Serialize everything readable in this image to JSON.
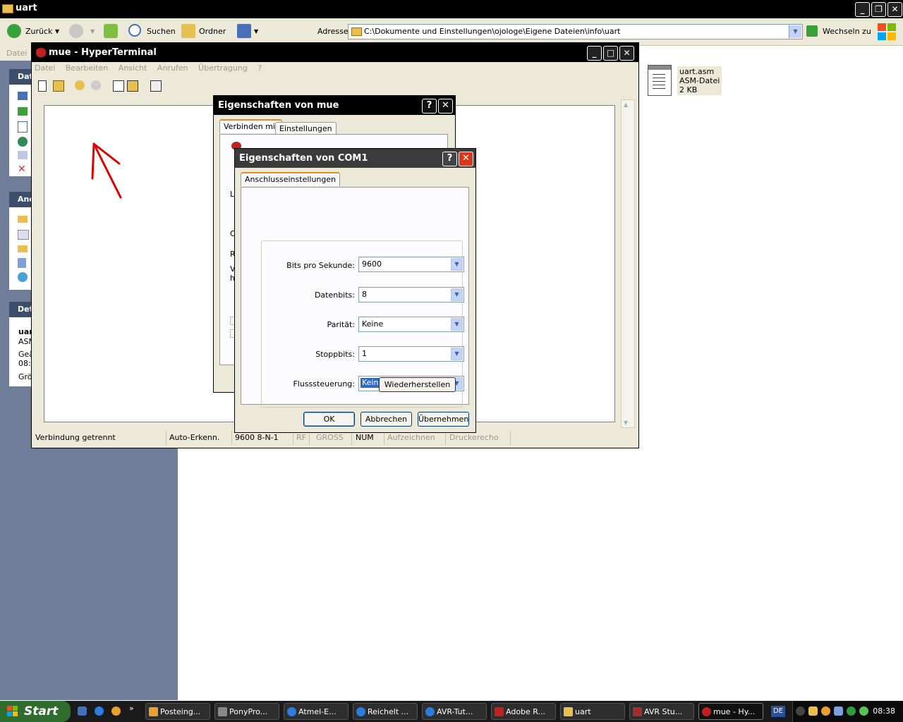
{
  "explorer": {
    "title": "uart",
    "toolbar": {
      "back": "Zurück",
      "search": "Suchen",
      "folders": "Ordner"
    },
    "address_label": "Adresse",
    "address_value": "C:\\Dokumente und Einstellungen\\ojologe\\Eigene Dateien\\info\\uart",
    "go_label": "Wechseln zu",
    "menu_first": "Datei",
    "left_pane": {
      "section1": "Dat",
      "section2": "And",
      "section3": "Det",
      "details": [
        "uar",
        "ASM",
        "Geä",
        "08:",
        "Grö"
      ]
    },
    "file": {
      "name": "uart.asm",
      "type": "ASM-Datei",
      "size": "2 KB"
    }
  },
  "hyperterminal": {
    "title": "mue - HyperTerminal",
    "menu": [
      "Datei",
      "Bearbeiten",
      "Ansicht",
      "Anrufen",
      "Übertragung",
      "?"
    ],
    "status": [
      "Verbindung getrennt",
      "Auto-Erkenn.",
      "9600 8-N-1",
      "RF",
      "GROSS",
      "NUM",
      "Aufzeichnen",
      "Druckerecho"
    ]
  },
  "dialog_properties": {
    "title": "Eigenschaften von mue",
    "tabs": [
      "Verbinden mit",
      "Einstellungen"
    ],
    "partial_labels": [
      "L",
      "O",
      "R",
      "V",
      "h"
    ]
  },
  "dialog_com": {
    "title": "Eigenschaften von COM1",
    "tab": "Anschlusseinstellungen",
    "fields": [
      {
        "label": "Bits pro Sekunde:",
        "value": "9600"
      },
      {
        "label": "Datenbits:",
        "value": "8"
      },
      {
        "label": "Parität:",
        "value": "Keine"
      },
      {
        "label": "Stoppbits:",
        "value": "1"
      },
      {
        "label": "Flusssteuerung:",
        "value": "Kein"
      }
    ],
    "restore_label": "Wiederherstellen",
    "ok_label": "OK",
    "cancel_label": "Abbrechen",
    "apply_label": "Übernehmen"
  },
  "taskbar": {
    "start_label": "Start",
    "items": [
      "Posteing...",
      "PonyPro...",
      "Atmel-E...",
      "Reichelt ...",
      "AVR-Tut...",
      "Adobe R...",
      "uart",
      "AVR Stu...",
      "mue - Hy..."
    ],
    "lang": "DE",
    "clock": "08:38"
  },
  "colors": {
    "selection": "#316ac5",
    "annotation": "#e00000",
    "left_pane": "#6f7d98"
  }
}
